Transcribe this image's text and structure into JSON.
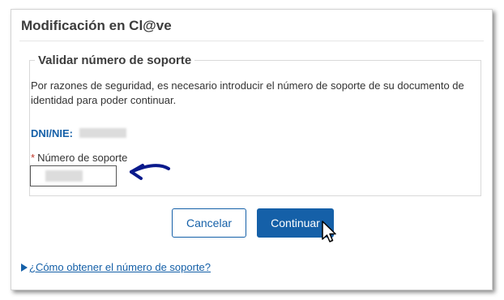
{
  "window": {
    "title": "Modificación en Cl@ve"
  },
  "panel": {
    "legend": "Validar número de soporte",
    "help_text": "Por razones de seguridad, es necesario introducir el número de soporte de su documento de identidad para poder continuar.",
    "dni_label": "DNI/NIE:",
    "dni_value_masked": true,
    "field": {
      "required_mark": "*",
      "label": "Número de soporte",
      "value_masked": true
    }
  },
  "buttons": {
    "cancel_label": "Cancelar",
    "continue_label": "Continuar"
  },
  "help_link": {
    "text": "¿Cómo obtener el número de soporte?",
    "icon": "triangle-right-icon"
  },
  "annotations": {
    "arrow_icon": "hand-drawn-arrow-icon",
    "arrow_color": "#0a1a8c",
    "cursor_icon": "mouse-pointer-icon"
  },
  "colors": {
    "accent": "#1560a8",
    "title_text": "#3c3c3c",
    "required": "#c0392b"
  }
}
